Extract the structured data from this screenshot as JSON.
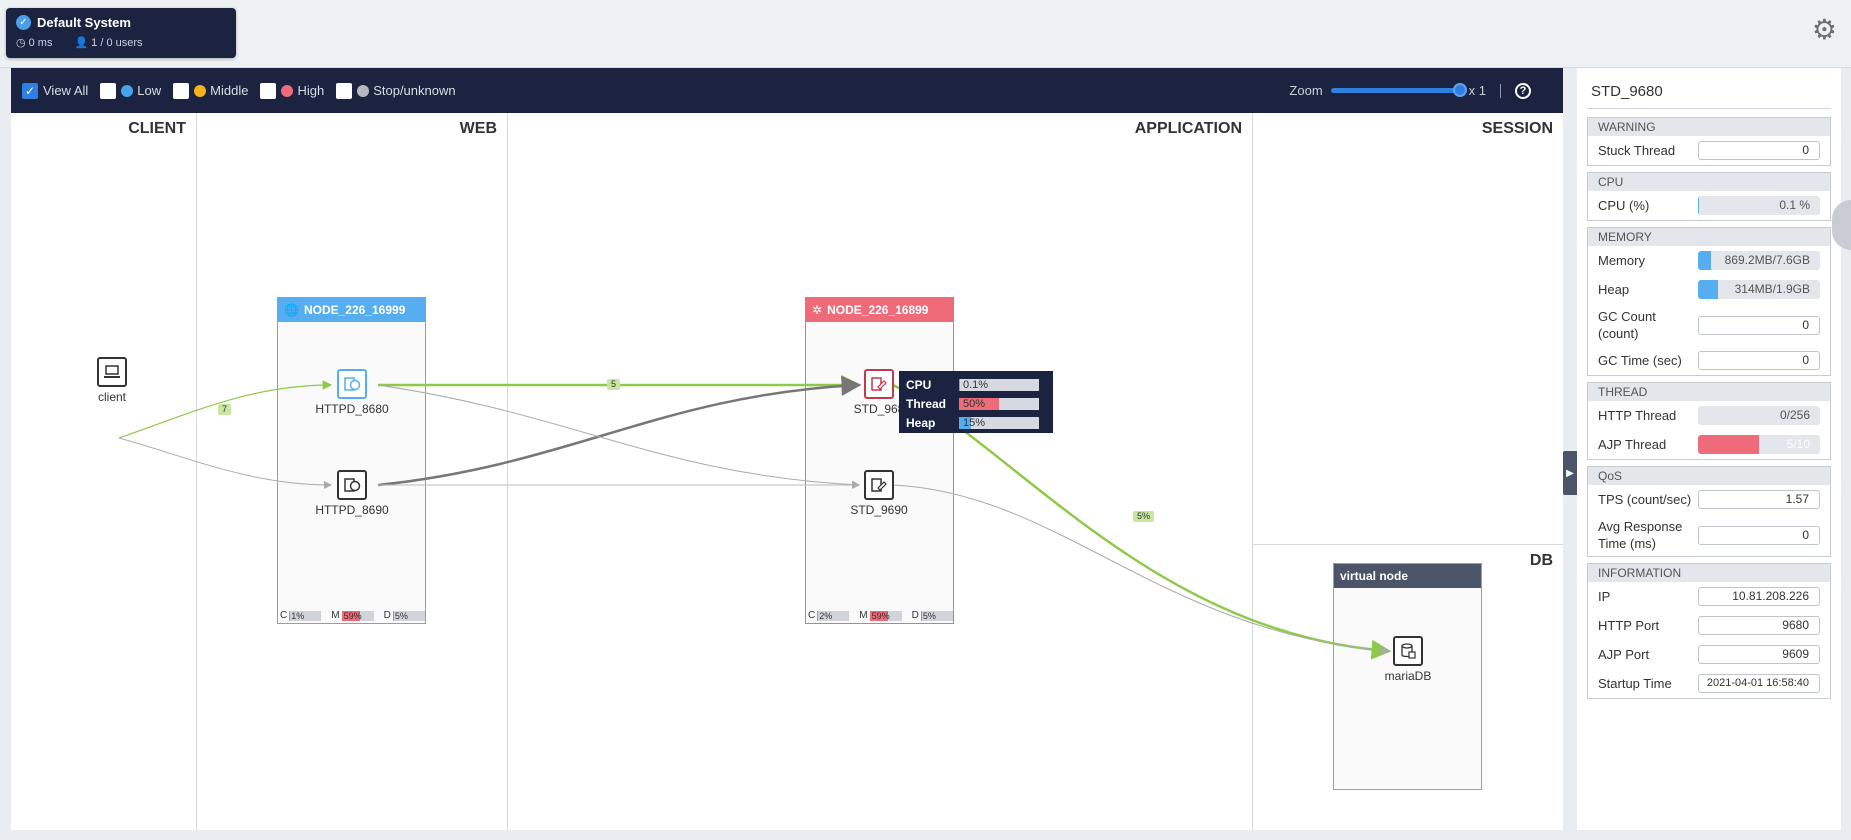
{
  "system": {
    "title": "Default System",
    "latency": "0 ms",
    "users": "1 / 0 users"
  },
  "toolbar": {
    "filters": [
      {
        "label": "View All",
        "checked": true,
        "dot": ""
      },
      {
        "label": "Low",
        "checked": false,
        "dot": "#4aa3e8"
      },
      {
        "label": "Middle",
        "checked": false,
        "dot": "#f2b31b"
      },
      {
        "label": "High",
        "checked": false,
        "dot": "#ef6b7a"
      },
      {
        "label": "Stop/unknown",
        "checked": false,
        "dot": "#b5b9bf"
      }
    ],
    "zoom_label": "Zoom",
    "zoom_value": "x 1",
    "help": "?"
  },
  "lanes": {
    "client": "CLIENT",
    "web": "WEB",
    "application": "APPLICATION",
    "session": "SESSION",
    "db": "DB"
  },
  "nodes": {
    "web": {
      "title": "NODE_226_16999",
      "color": "#56aef0",
      "stats": [
        {
          "k": "C",
          "v": "1%",
          "pct": 1,
          "color": "#56aef0"
        },
        {
          "k": "M",
          "v": "59%",
          "pct": 59,
          "color": "#ef6b7a"
        },
        {
          "k": "D",
          "v": "5%",
          "pct": 5,
          "color": "#56aef0"
        }
      ]
    },
    "app": {
      "title": "NODE_226_16899",
      "color": "#ef6b7a",
      "stats": [
        {
          "k": "C",
          "v": "2%",
          "pct": 2,
          "color": "#56aef0"
        },
        {
          "k": "M",
          "v": "59%",
          "pct": 59,
          "color": "#ef6b7a"
        },
        {
          "k": "D",
          "v": "5%",
          "pct": 5,
          "color": "#56aef0"
        }
      ]
    },
    "virtual": {
      "title": "virtual node",
      "color": "#4b5468"
    }
  },
  "services": {
    "client": "client",
    "httpd1": "HTTPD_8680",
    "httpd2": "HTTPD_8690",
    "std1": "STD_968",
    "std2": "STD_9690",
    "db": "mariaDB"
  },
  "edges": {
    "client_httpd": "7",
    "httpd_std": "5",
    "std_db": "5%"
  },
  "tooltip": [
    {
      "label": "CPU",
      "value": "0.1%",
      "pct": 0.1,
      "color": "#56aef0"
    },
    {
      "label": "Thread",
      "value": "50%",
      "pct": 50,
      "color": "#ef6b7a"
    },
    {
      "label": "Heap",
      "value": "15%",
      "pct": 15,
      "color": "#56aef0"
    }
  ],
  "panel": {
    "title": "STD_9680",
    "warning": {
      "head": "WARNING",
      "stuck_label": "Stuck Thread",
      "stuck_value": "0"
    },
    "cpu": {
      "head": "CPU",
      "label": "CPU (%)",
      "value": "0.1 %",
      "pct": 0.1
    },
    "memory": {
      "head": "MEMORY",
      "mem_label": "Memory",
      "mem_value": "869.2MB/7.6GB",
      "mem_pct": 11,
      "heap_label": "Heap",
      "heap_value": "314MB/1.9GB",
      "heap_pct": 16,
      "gc_count_label": "GC Count (count)",
      "gc_count_value": "0",
      "gc_time_label": "GC Time (sec)",
      "gc_time_value": "0"
    },
    "thread": {
      "head": "THREAD",
      "http_label": "HTTP Thread",
      "http_value": "0/256",
      "http_pct": 0,
      "ajp_label": "AJP Thread",
      "ajp_value": "5/10",
      "ajp_pct": 50
    },
    "qos": {
      "head": "QoS",
      "tps_label": "TPS (count/sec)",
      "tps_value": "1.57",
      "avg_label": "Avg Response Time (ms)",
      "avg_value": "0"
    },
    "info": {
      "head": "INFORMATION",
      "ip_label": "IP",
      "ip_value": "10.81.208.226",
      "http_port_label": "HTTP Port",
      "http_port_value": "9680",
      "ajp_port_label": "AJP Port",
      "ajp_port_value": "9609",
      "startup_label": "Startup Time",
      "startup_value": "2021-04-01 16:58:40"
    }
  },
  "colors": {
    "navy": "#1b2340",
    "blue": "#56aef0",
    "red": "#ef6b7a",
    "green": "#8fc94a"
  }
}
